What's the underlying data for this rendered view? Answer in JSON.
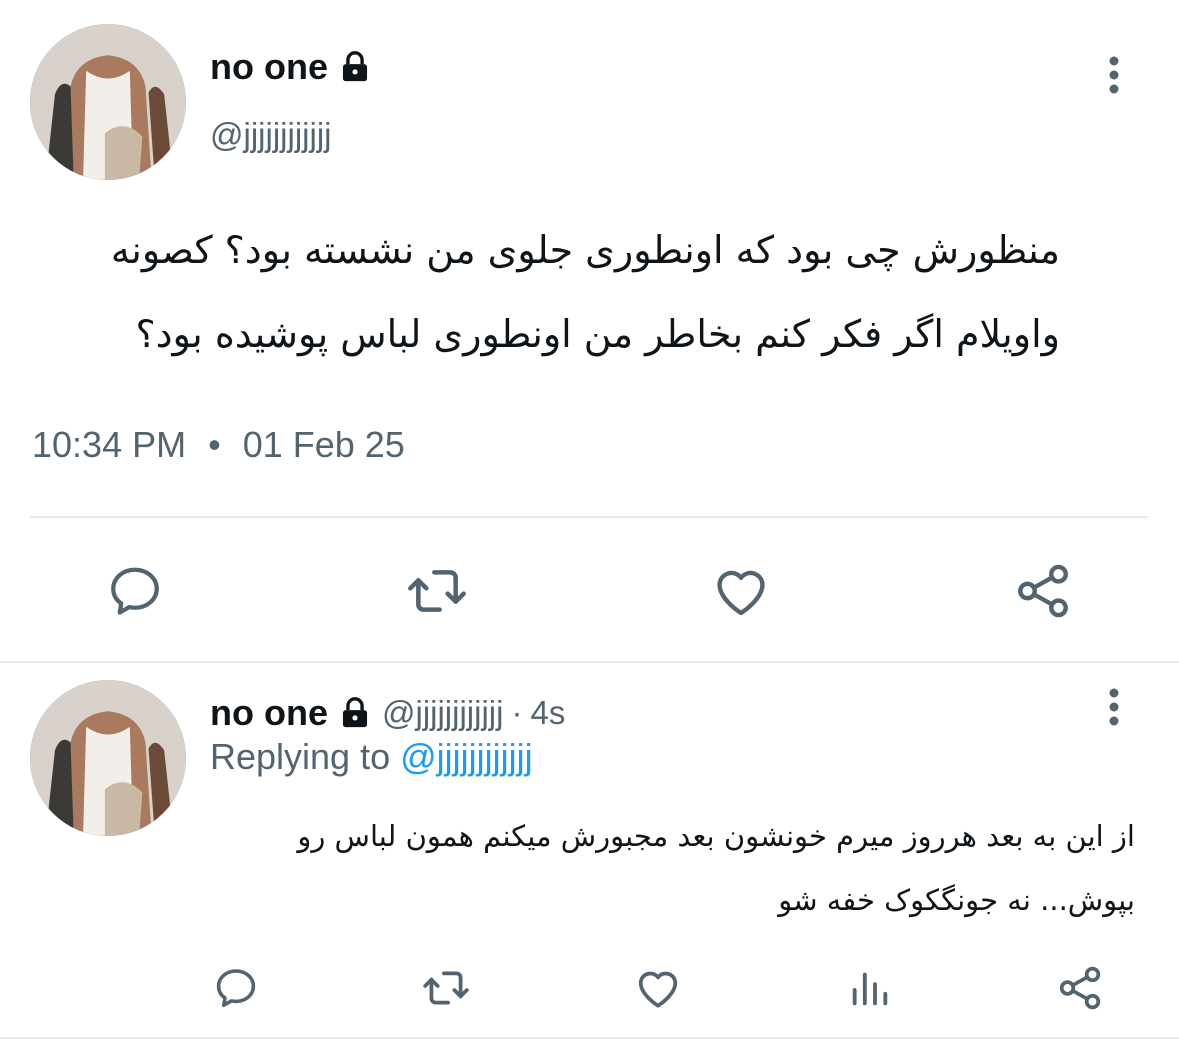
{
  "main_tweet": {
    "display_name": "no one",
    "handle": "@jjjjjjjjjjjj",
    "text_lines": [
      "منظورش چی بود که اونطوری جلوی من نشسته بود؟ کصونه",
      "واویلام اگر فکر کنم بخاطر من اونطوری لباس پوشیده بود؟"
    ],
    "time": "10:34 PM",
    "separator": "•",
    "date": "01 Feb 25"
  },
  "reply_tweet": {
    "display_name": "no one",
    "handle": "@jjjjjjjjjjjj",
    "time_sep": "·",
    "age": "4s",
    "replying_to_label": "Replying to",
    "replying_to_handle": "@jjjjjjjjjjjj",
    "text_lines": [
      "از این به بعد هرروز میرم خونشون بعد مجبورش میکنم همون لباس رو",
      "بپوش... نه جونگکوک خفه شو"
    ]
  },
  "icons": {
    "more": "more-vertical-icon",
    "lock": "lock-icon",
    "reply": "reply-icon",
    "retweet": "retweet-icon",
    "like": "heart-icon",
    "views": "analytics-icon",
    "share": "share-icon"
  },
  "colors": {
    "text": "#0f1419",
    "secondary": "#536471",
    "link": "#1d9bf0",
    "divider": "#e6ebee"
  }
}
